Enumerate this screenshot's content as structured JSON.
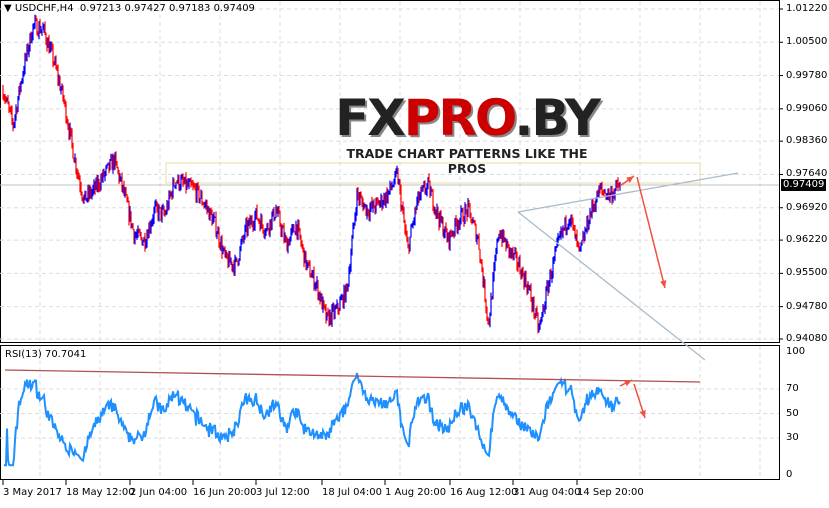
{
  "header": {
    "symbol": "USDCHF,H4",
    "open": "0.97213",
    "high": "0.97427",
    "low": "0.97183",
    "close": "0.97409"
  },
  "price_axis": [
    "1.01220",
    "1.00500",
    "0.99780",
    "0.99060",
    "0.98360",
    "0.97640",
    "0.96920",
    "0.96220",
    "0.95500",
    "0.94780",
    "0.94080"
  ],
  "current_price": "0.97409",
  "rsi": {
    "label": "RSI(13) 70.7041",
    "axis": [
      "100",
      "70",
      "50",
      "30",
      "0"
    ]
  },
  "time_axis": [
    "3 May 2017",
    "18 May 12:00",
    "2 Jun 04:00",
    "16 Jun 20:00",
    "3 Jul 12:00",
    "18 Jul 04:00",
    "1 Aug 20:00",
    "16 Aug 12:00",
    "31 Aug 04:00",
    "14 Sep 20:00"
  ],
  "watermark": {
    "brand": "FXPRO.BY",
    "tagline": "TRADE CHART PATTERNS LIKE THE PROS"
  },
  "colors": {
    "up": "#0000ff",
    "down": "#ff0000",
    "rsi": "#1e90ff",
    "trend": "#a8bccb",
    "arrow": "#f05040"
  },
  "chart_data": {
    "type": "line",
    "title": "USDCHF,H4",
    "ylim": [
      0.9408,
      1.0122
    ],
    "rsi_ylim": [
      0,
      100
    ],
    "waypoints": [
      0.99467,
      0.9871,
      0.999,
      1.00874,
      1.00766,
      1.00116,
      0.99251,
      0.98061,
      0.97087,
      0.97303,
      0.97628,
      0.97952,
      0.97195,
      0.96329,
      0.96221,
      0.9687,
      0.96762,
      0.9752,
      0.97411,
      0.97303,
      0.96979,
      0.96546,
      0.95788,
      0.9568,
      0.96438,
      0.96762,
      0.96438,
      0.9687,
      0.96113,
      0.96546,
      0.9568,
      0.95247,
      0.9449,
      0.94706,
      0.95139,
      0.97195,
      0.9687,
      0.96979,
      0.97195,
      0.97628,
      0.96005,
      0.97087,
      0.97411,
      0.96762,
      0.96221,
      0.96654,
      0.9687,
      0.96221,
      0.94382,
      0.96438,
      0.96005,
      0.9568,
      0.95139,
      0.94274,
      0.95356,
      0.96221,
      0.96762,
      0.95897,
      0.96762,
      0.97303,
      0.97195,
      0.97409
    ]
  }
}
